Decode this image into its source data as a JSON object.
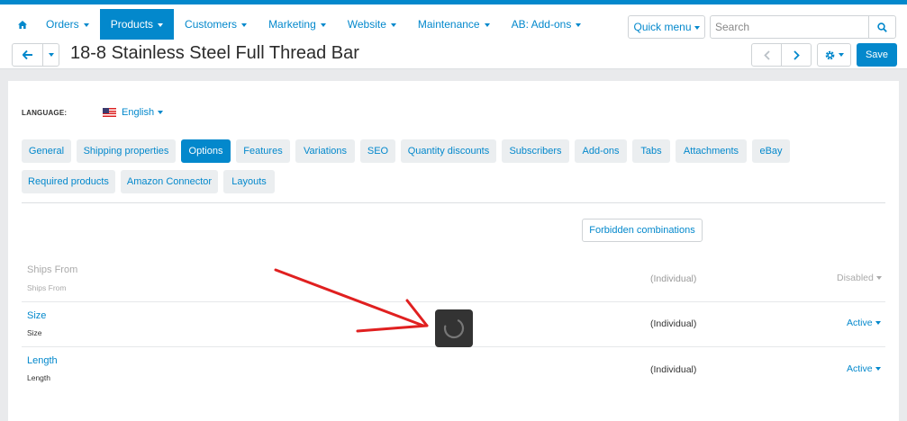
{
  "nav": {
    "items": [
      {
        "label": "Orders"
      },
      {
        "label": "Products"
      },
      {
        "label": "Customers"
      },
      {
        "label": "Marketing"
      },
      {
        "label": "Website"
      },
      {
        "label": "Maintenance"
      },
      {
        "label": "AB: Add-ons"
      }
    ],
    "quick_menu": "Quick menu",
    "search_placeholder": "Search"
  },
  "title": "18-8 Stainless Steel Full Thread Bar",
  "save_label": "Save",
  "language": {
    "label": "LANGUAGE:",
    "value": "English"
  },
  "tabs": [
    {
      "label": "General"
    },
    {
      "label": "Shipping properties"
    },
    {
      "label": "Options"
    },
    {
      "label": "Features"
    },
    {
      "label": "Variations"
    },
    {
      "label": "SEO"
    },
    {
      "label": "Quantity discounts"
    },
    {
      "label": "Subscribers"
    },
    {
      "label": "Add-ons"
    },
    {
      "label": "Tabs"
    },
    {
      "label": "Attachments"
    },
    {
      "label": "eBay"
    },
    {
      "label": "Required products"
    },
    {
      "label": "Amazon Connector"
    },
    {
      "label": "Layouts"
    }
  ],
  "forbidden_label": "Forbidden combinations",
  "options": [
    {
      "name": "Ships From",
      "sub": "Ships From",
      "type": "(Individual)",
      "status": "Disabled"
    },
    {
      "name": "Size",
      "sub": "Size",
      "type": "(Individual)",
      "status": "Active"
    },
    {
      "name": "Length",
      "sub": "Length",
      "type": "(Individual)",
      "status": "Active"
    }
  ],
  "colors": {
    "accent": "#0388cc",
    "annotation_arrow": "#e02020"
  },
  "icons": {
    "home": "home-icon",
    "search": "search-icon",
    "back": "arrow-left-icon",
    "prev": "chevron-left-icon",
    "next": "chevron-right-icon",
    "settings": "gear-icon",
    "loading": "spinner-icon"
  }
}
